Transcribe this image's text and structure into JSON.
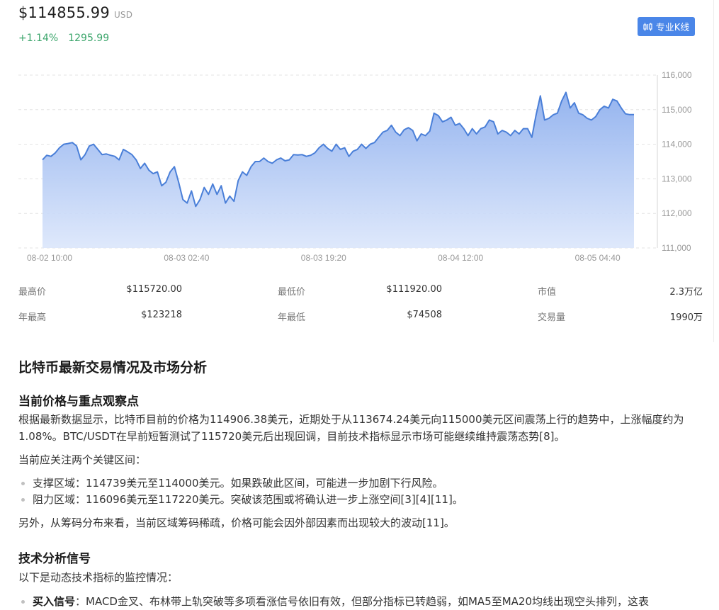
{
  "header": {
    "price": "$114855.99",
    "unit": "USD",
    "change_pct": "+1.14%",
    "change_abs": "1295.99",
    "kline_button": "专业K线",
    "up_color": "#3ba56b",
    "accent_color": "#4a86e8"
  },
  "chart_data": {
    "type": "area",
    "x_tick_labels": [
      "08-02 10:00",
      "08-03 02:40",
      "08-03 19:20",
      "08-04 12:00",
      "08-05 04:40"
    ],
    "y_tick_labels": [
      "116,000",
      "115,000",
      "114,000",
      "113,000",
      "112,000",
      "111,000"
    ],
    "ylim": [
      111000,
      116000
    ],
    "grid": true,
    "line_color": "#4a7fd8",
    "values": [
      113550,
      113680,
      113650,
      113750,
      113900,
      114000,
      114020,
      114050,
      113950,
      113550,
      113700,
      113950,
      114000,
      113850,
      113700,
      113720,
      113680,
      113650,
      113550,
      113850,
      113780,
      113700,
      113550,
      113300,
      113450,
      113250,
      113150,
      113200,
      112800,
      112900,
      113200,
      113350,
      112900,
      112400,
      112300,
      112650,
      112200,
      112400,
      112750,
      112550,
      112850,
      112550,
      112800,
      112300,
      112500,
      112350,
      112950,
      113200,
      113100,
      113350,
      113500,
      113500,
      113600,
      113500,
      113450,
      113550,
      113600,
      113520,
      113550,
      113700,
      113690,
      113700,
      113650,
      113680,
      113750,
      113900,
      114000,
      113880,
      113800,
      114000,
      113850,
      113900,
      113650,
      113800,
      113850,
      114000,
      113880,
      114000,
      114050,
      114200,
      114350,
      114400,
      114550,
      114350,
      114250,
      114420,
      114480,
      114400,
      114100,
      114300,
      114250,
      114380,
      114900,
      114830,
      114650,
      114700,
      114780,
      114550,
      114600,
      114450,
      114250,
      114450,
      114300,
      114450,
      114500,
      114700,
      114650,
      114300,
      114400,
      114350,
      114250,
      114400,
      114300,
      114450,
      114450,
      114200,
      114850,
      115400,
      114700,
      114750,
      114850,
      114900,
      115250,
      115500,
      115050,
      115200,
      114900,
      114850,
      114750,
      114700,
      114800,
      115000,
      115100,
      115050,
      115300,
      115250,
      115050,
      114880,
      114856,
      114856
    ]
  },
  "stats": {
    "row1": [
      {
        "label": "最高价",
        "value": "$115720.00"
      },
      {
        "label": "最低价",
        "value": "$111920.00"
      },
      {
        "label": "市值",
        "value": "2.3万亿"
      }
    ],
    "row2": [
      {
        "label": "年最高",
        "value": "$123218"
      },
      {
        "label": "年最低",
        "value": "$74508"
      },
      {
        "label": "交易量",
        "value": "1990万"
      }
    ]
  },
  "article": {
    "title": "比特币最新交易情况及市场分析",
    "section1_title": "当前价格与重点观察点",
    "section1_para": "根据最新数据显示，比特币目前的价格为114906.38美元，近期处于从113674.24美元向115000美元区间震荡上行的趋势中，上涨幅度约为1.08%。BTC/USDT在早前短暂测试了115720美元后出现回调，目前技术指标显示市场可能继续维持震荡态势[8]。",
    "section1_intro": "当前应关注两个关键区间：",
    "bullets": [
      "支撑区域：114739美元至114000美元。如果跌破此区间，可能进一步加剧下行风险。",
      "阻力区域：116096美元至117220美元。突破该范围或将确认进一步上涨空间[3][4][11]。"
    ],
    "section1_outro": "另外，从筹码分布来看，当前区域筹码稀疏，价格可能会因外部因素而出现较大的波动[11]。",
    "section2_title": "技术分析信号",
    "section2_intro": "以下是动态技术指标的监控情况：",
    "buy_signal_label": "买入信号",
    "buy_signal_text": "：MACD金叉、布林带上轨突破等多项看涨信号依旧有效，但部分指标已转趋弱，如MA5至MA20均线出现空头排列，这表"
  }
}
